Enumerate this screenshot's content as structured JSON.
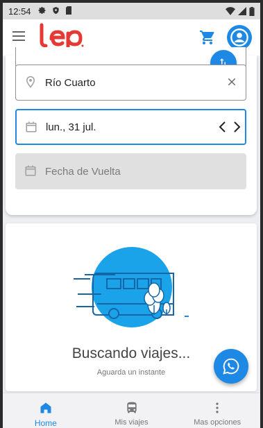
{
  "status_bar": {
    "time": "12:54"
  },
  "app_bar": {
    "logo_text": "lep",
    "brand_color": "#e53935"
  },
  "search": {
    "origin": "Río Cuarto",
    "departure_date": "lun., 31 jul.",
    "return_placeholder": "Fecha de Vuelta",
    "date_prev": "<",
    "date_next": ">"
  },
  "loading": {
    "title": "Buscando viajes...",
    "subtitle": "Aguarda un instante"
  },
  "bottom_nav": {
    "items": [
      {
        "label": "Home",
        "icon": "home-icon",
        "active": true
      },
      {
        "label": "Mis viajes",
        "icon": "bus-icon",
        "active": false
      },
      {
        "label": "Mas opciones",
        "icon": "more-vert-icon",
        "active": false
      }
    ]
  },
  "colors": {
    "accent": "#1e88e5",
    "brand": "#e53935",
    "illustration_bg": "#1aa3e8"
  }
}
